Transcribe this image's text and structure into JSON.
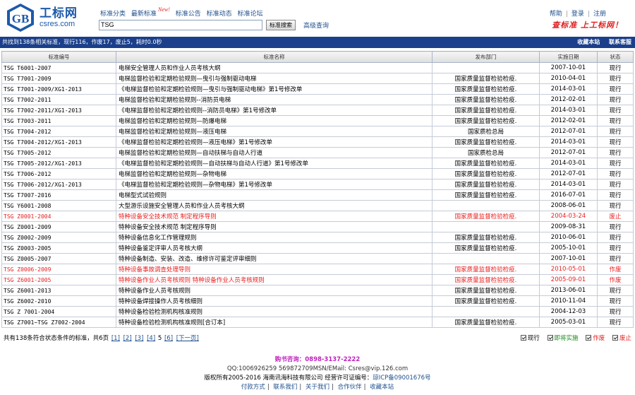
{
  "logo": {
    "cn": "工标网",
    "en": "csres.com"
  },
  "topnav": {
    "items": [
      "标准分类",
      "最新标准",
      "标准公告",
      "标准动态",
      "标准论坛"
    ],
    "new_badge": "New!"
  },
  "search": {
    "value": "TSG",
    "button": "标准搜索",
    "advanced": "高级查询"
  },
  "rightnav": {
    "help": "帮助",
    "login": "登录",
    "register": "注册",
    "slogan": "查标准 上工标网！"
  },
  "infobar": {
    "summary": "共找到138条相关标准，现行116，作废17，废止5，耗时0.0秒",
    "bookmark": "收藏本站",
    "contact": "联系客服"
  },
  "table": {
    "headers": [
      "标准编号",
      "标准名称",
      "发布部门",
      "实施日期",
      "状态"
    ],
    "rows": [
      {
        "code": "TSG T6001-2007",
        "name": "电梯安全管理人员和作业人员考核大纲",
        "dept": "",
        "date": "2007-10-01",
        "status": "现行",
        "red": false
      },
      {
        "code": "TSG T7001-2009",
        "name": "电梯监督检验和定期检验规则—曳引与强制驱动电梯",
        "dept": "国家质量监督检验检疫.",
        "date": "2010-04-01",
        "status": "现行",
        "red": false
      },
      {
        "code": "TSG T7001-2009/XG1-2013",
        "name": "《电梯监督检验和定期检验规则—曳引与强制驱动电梯》第1号修改单",
        "dept": "国家质量监督检验检疫.",
        "date": "2014-03-01",
        "status": "现行",
        "red": false
      },
      {
        "code": "TSG T7002-2011",
        "name": "电梯监督检验和定期检验规则--消防员电梯",
        "dept": "国家质量监督检验检疫.",
        "date": "2012-02-01",
        "status": "现行",
        "red": false
      },
      {
        "code": "TSG T7002-2011/XG1-2013",
        "name": "《电梯监督检验和定期检验规则--消防员电梯》第1号修改单",
        "dept": "国家质量监督检验检疫.",
        "date": "2014-03-01",
        "status": "现行",
        "red": false
      },
      {
        "code": "TSG T7003-2011",
        "name": "电梯监督检验和定期检验规则—防爆电梯",
        "dept": "国家质量监督检验检疫.",
        "date": "2012-02-01",
        "status": "现行",
        "red": false
      },
      {
        "code": "TSG T7004-2012",
        "name": "电梯监督检验和定期检验规则—液压电梯",
        "dept": "国家质检总局",
        "date": "2012-07-01",
        "status": "现行",
        "red": false
      },
      {
        "code": "TSG T7004-2012/XG1-2013",
        "name": "《电梯监督检验和定期检验规则—液压电梯》第1号修改单",
        "dept": "国家质量监督检验检疫.",
        "date": "2014-03-01",
        "status": "现行",
        "red": false
      },
      {
        "code": "TSG T7005-2012",
        "name": "电梯监督检验和定期检验规则—自动扶梯与自动人行道",
        "dept": "国家质检总局",
        "date": "2012-07-01",
        "status": "现行",
        "red": false
      },
      {
        "code": "TSG T7005-2012/XG1-2013",
        "name": "《电梯监督检验和定期检验规则—自动扶梯与自动人行道》第1号修改单",
        "dept": "国家质量监督检验检疫.",
        "date": "2014-03-01",
        "status": "现行",
        "red": false
      },
      {
        "code": "TSG T7006-2012",
        "name": "电梯监督检验和定期检验规则—杂物电梯",
        "dept": "国家质量监督检验检疫.",
        "date": "2012-07-01",
        "status": "现行",
        "red": false
      },
      {
        "code": "TSG T7006-2012/XG1-2013",
        "name": "《电梯监督检验和定期检验规则—杂物电梯》第1号修改单",
        "dept": "国家质量监督检验检疫.",
        "date": "2014-03-01",
        "status": "现行",
        "red": false
      },
      {
        "code": "TSG T7007-2016",
        "name": "电梯型式试验规则",
        "dept": "国家质量监督检验检疫.",
        "date": "2016-07-01",
        "status": "现行",
        "red": false
      },
      {
        "code": "TSG Y6001-2008",
        "name": "大型游乐设施安全管理人员和作业人员考核大纲",
        "dept": "",
        "date": "2008-06-01",
        "status": "现行",
        "red": false
      },
      {
        "code": "TSG Z0001-2004",
        "name": "特种设备安全技术规范  制定程序导则",
        "dept": "国家质量监督检验检疫.",
        "date": "2004-03-24",
        "status": "废止",
        "red": true
      },
      {
        "code": "TSG Z0001-2009",
        "name": "特种设备安全技术规范 制定程序导则",
        "dept": "",
        "date": "2009-08-31",
        "status": "现行",
        "red": false
      },
      {
        "code": "TSG Z0002-2009",
        "name": "特种设备信息化工作管理规则",
        "dept": "国家质量监督检验检疫.",
        "date": "2010-06-01",
        "status": "现行",
        "red": false
      },
      {
        "code": "TSG Z0003-2005",
        "name": "特种设备鉴定评审人员考核大纲",
        "dept": "国家质量监督检验检疫.",
        "date": "2005-10-01",
        "status": "现行",
        "red": false
      },
      {
        "code": "TSG Z0005-2007",
        "name": "特种设备制造、安装、改造、维修许可鉴定评审细则",
        "dept": "",
        "date": "2007-10-01",
        "status": "现行",
        "red": false
      },
      {
        "code": "TSG Z0006-2009",
        "name": "特种设备事故调查处理导则",
        "dept": "国家质量监督检验检疫.",
        "date": "2010-05-01",
        "status": "作废",
        "red": true
      },
      {
        "code": "TSG Z6001-2005",
        "name": "特种设备作业人员考核规则  特种设备作业人员考核规则",
        "dept": "国家质量监督检验检疫.",
        "date": "2005-09-01",
        "status": "作废",
        "red": true
      },
      {
        "code": "TSG Z6001-2013",
        "name": "特种设备作业人员考核规则",
        "dept": "国家质量监督检验检疫.",
        "date": "2013-06-01",
        "status": "现行",
        "red": false
      },
      {
        "code": "TSG Z6002-2010",
        "name": "特种设备焊接操作人员考核细则",
        "dept": "国家质量监督检验检疫.",
        "date": "2010-11-04",
        "status": "现行",
        "red": false
      },
      {
        "code": "TSG Z 7001-2004",
        "name": "特种设备检验检测机构核准规则",
        "dept": "",
        "date": "2004-12-03",
        "status": "现行",
        "red": false
      },
      {
        "code": "TSG Z7001~TSG Z7002-2004",
        "name": "特种设备检验检测机构核准规则[合订本]",
        "dept": "国家质量监督检验检疫.",
        "date": "2005-03-01",
        "status": "现行",
        "red": false
      }
    ]
  },
  "pager": {
    "prefix": "共有138条符合状态条件的标准，共6页",
    "pages": [
      "[1]",
      "[2]",
      "[3]",
      "[4]"
    ],
    "current": "5",
    "last": "[6]",
    "next": "[下一页]"
  },
  "legend": [
    "现行",
    "即将实施",
    "作废",
    "废止"
  ],
  "colors": {
    "legend": [
      "#000000",
      "#1a8a1a",
      "#e02020",
      "#e02020"
    ],
    "accent": "#1b3f8a",
    "red": "#e82020"
  },
  "footer": {
    "buy": "购书咨询：0898-3137-2222",
    "qq": "QQ:1006926259 569872709MSN/EMail: Csres@vip.126.com",
    "copyright": "版权所有2005-2016 海南讯海科技有限公司 经营许可证编号：",
    "icp": "琼ICP备09001676号",
    "nav": [
      "付款方式",
      "联系我们",
      "关于我们",
      "合作伙伴",
      "收藏本站"
    ]
  }
}
